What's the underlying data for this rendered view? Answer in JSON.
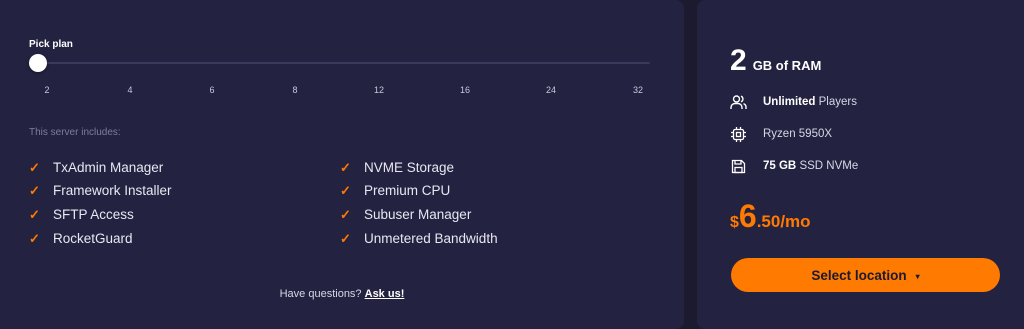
{
  "plan_picker": {
    "label": "Pick plan",
    "ticks": [
      "2",
      "4",
      "6",
      "8",
      "12",
      "16",
      "24",
      "32"
    ],
    "selected": "2"
  },
  "includes": {
    "label": "This server includes:",
    "left": [
      "TxAdmin Manager",
      "Framework Installer",
      "SFTP Access",
      "RocketGuard"
    ],
    "right": [
      "NVME Storage",
      "Premium CPU",
      "Subuser Manager",
      "Unmetered Bandwidth"
    ],
    "check_glyph": "✓"
  },
  "questions": {
    "text": "Have questions?",
    "link": "Ask us!"
  },
  "plan": {
    "ram_amount": "2",
    "ram_label": "GB of RAM",
    "players_bold": "Unlimited",
    "players_text": "Players",
    "cpu": "Ryzen 5950X",
    "storage_bold": "75 GB",
    "storage_text": "SSD NVMe",
    "price_currency": "$",
    "price_int": "6",
    "price_rest": ".50/mo",
    "button_label": "Select location",
    "icons": [
      "users-icon",
      "cpu-icon",
      "save-icon",
      "chevron-down-icon"
    ]
  },
  "colors": {
    "accent": "#ff7a00",
    "panel": "#232240",
    "background": "#1b1a2e"
  }
}
